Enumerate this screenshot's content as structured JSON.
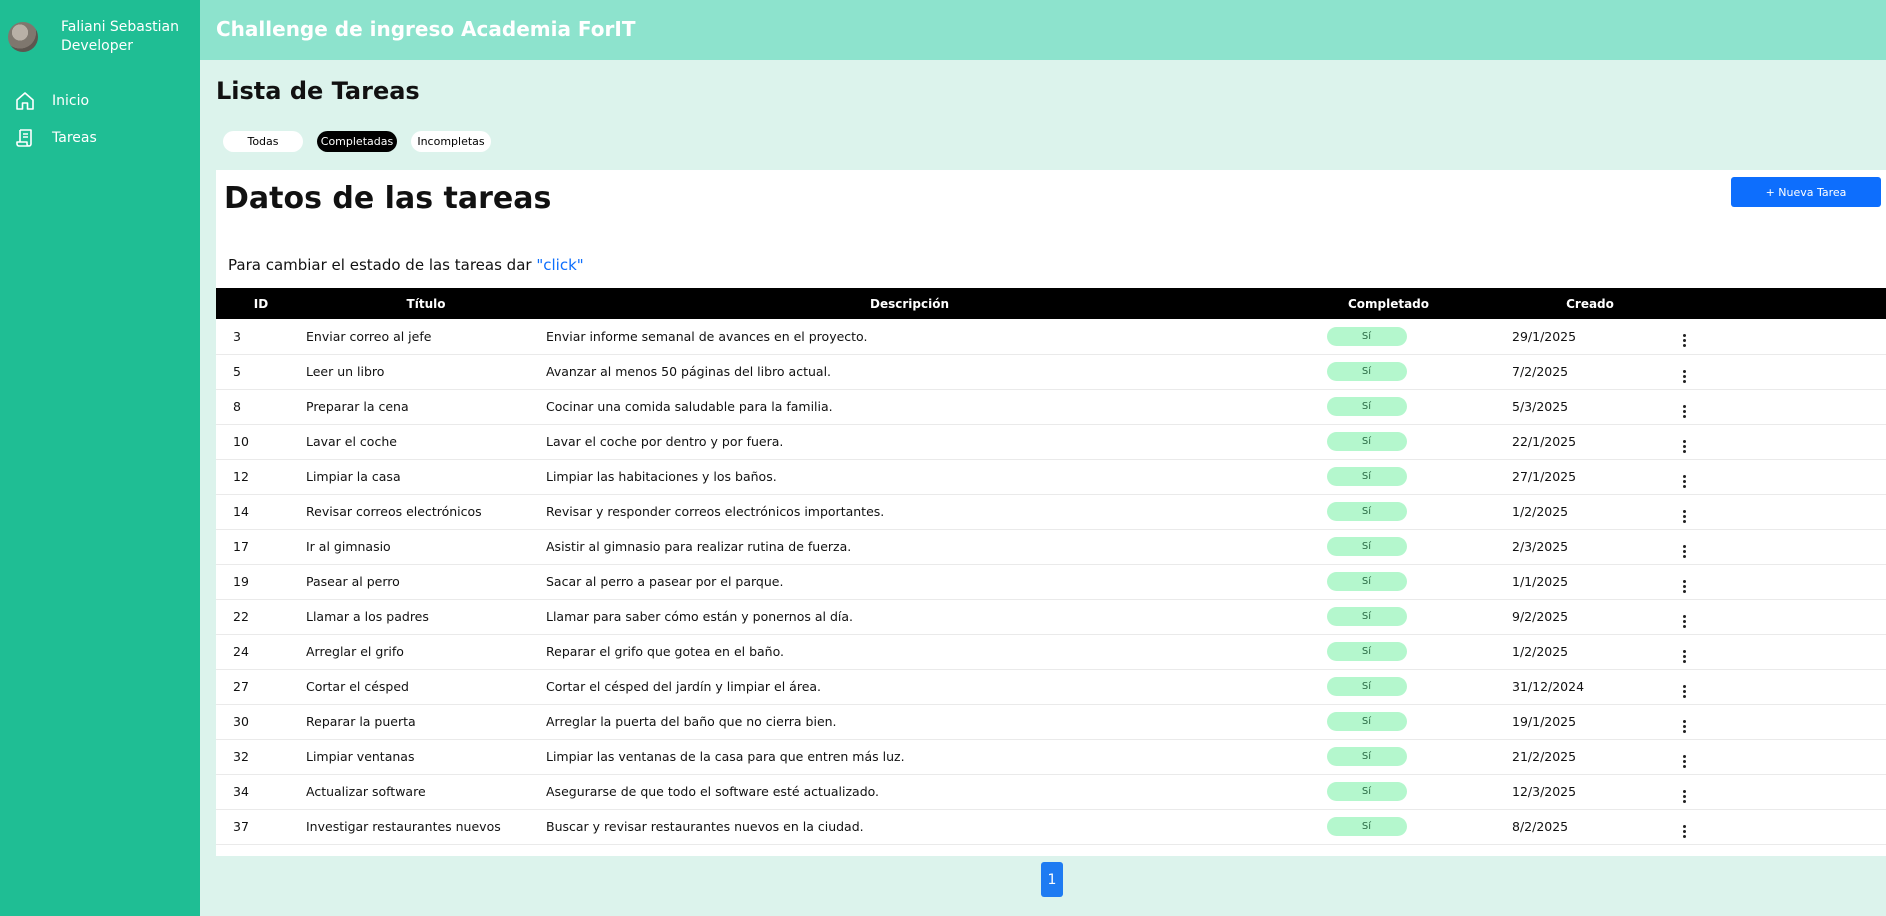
{
  "user": {
    "name": "Faliani Sebastian",
    "role": "Developer"
  },
  "sidebar": {
    "items": [
      {
        "label": "Inicio",
        "icon": "home-icon"
      },
      {
        "label": "Tareas",
        "icon": "document-icon"
      }
    ]
  },
  "header": {
    "title": "Challenge de ingreso Academia ForIT"
  },
  "page": {
    "title": "Lista de Tareas"
  },
  "filters": [
    {
      "label": "Todas",
      "active": false
    },
    {
      "label": "Completadas",
      "active": true
    },
    {
      "label": "Incompletas",
      "active": false
    }
  ],
  "panel": {
    "title": "Datos de las tareas",
    "new_button": "+ Nueva Tarea",
    "hint": "Para cambiar el estado de las tareas dar",
    "hint_click": "\"click\""
  },
  "table": {
    "columns": [
      "ID",
      "Título",
      "Descripción",
      "Completado",
      "Creado",
      ""
    ],
    "rows": [
      {
        "id": "3",
        "title": "Enviar correo al jefe",
        "description": "Enviar informe semanal de avances en el proyecto.",
        "completed": "Sí",
        "created": "29/1/2025"
      },
      {
        "id": "5",
        "title": "Leer un libro",
        "description": "Avanzar al menos 50 páginas del libro actual.",
        "completed": "Sí",
        "created": "7/2/2025"
      },
      {
        "id": "8",
        "title": "Preparar la cena",
        "description": "Cocinar una comida saludable para la familia.",
        "completed": "Sí",
        "created": "5/3/2025"
      },
      {
        "id": "10",
        "title": "Lavar el coche",
        "description": "Lavar el coche por dentro y por fuera.",
        "completed": "Sí",
        "created": "22/1/2025"
      },
      {
        "id": "12",
        "title": "Limpiar la casa",
        "description": "Limpiar las habitaciones y los baños.",
        "completed": "Sí",
        "created": "27/1/2025"
      },
      {
        "id": "14",
        "title": "Revisar correos electrónicos",
        "description": "Revisar y responder correos electrónicos importantes.",
        "completed": "Sí",
        "created": "1/2/2025"
      },
      {
        "id": "17",
        "title": "Ir al gimnasio",
        "description": "Asistir al gimnasio para realizar rutina de fuerza.",
        "completed": "Sí",
        "created": "2/3/2025"
      },
      {
        "id": "19",
        "title": "Pasear al perro",
        "description": "Sacar al perro a pasear por el parque.",
        "completed": "Sí",
        "created": "1/1/2025"
      },
      {
        "id": "22",
        "title": "Llamar a los padres",
        "description": "Llamar para saber cómo están y ponernos al día.",
        "completed": "Sí",
        "created": "9/2/2025"
      },
      {
        "id": "24",
        "title": "Arreglar el grifo",
        "description": "Reparar el grifo que gotea en el baño.",
        "completed": "Sí",
        "created": "1/2/2025"
      },
      {
        "id": "27",
        "title": "Cortar el césped",
        "description": "Cortar el césped del jardín y limpiar el área.",
        "completed": "Sí",
        "created": "31/12/2024"
      },
      {
        "id": "30",
        "title": "Reparar la puerta",
        "description": "Arreglar la puerta del baño que no cierra bien.",
        "completed": "Sí",
        "created": "19/1/2025"
      },
      {
        "id": "32",
        "title": "Limpiar ventanas",
        "description": "Limpiar las ventanas de la casa para que entren más luz.",
        "completed": "Sí",
        "created": "21/2/2025"
      },
      {
        "id": "34",
        "title": "Actualizar software",
        "description": "Asegurarse de que todo el software esté actualizado.",
        "completed": "Sí",
        "created": "12/3/2025"
      },
      {
        "id": "37",
        "title": "Investigar restaurantes nuevos",
        "description": "Buscar y revisar restaurantes nuevos en la ciudad.",
        "completed": "Sí",
        "created": "8/2/2025"
      }
    ]
  },
  "pagination": {
    "current": "1"
  },
  "colors": {
    "sidebar": "#1fbe94",
    "header": "#8de3cd",
    "background": "#dcf3ec",
    "accent": "#0d6efd",
    "badge": "#b4f7cd"
  }
}
